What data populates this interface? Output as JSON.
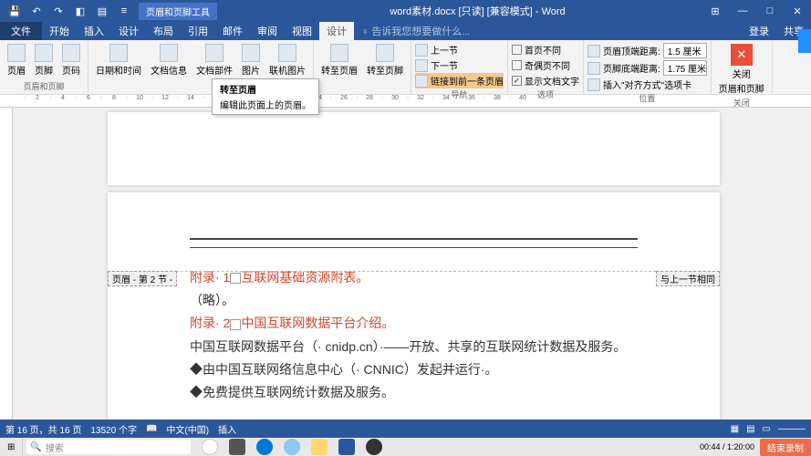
{
  "titlebar": {
    "tool_tab": "页眉和页脚工具",
    "filename": "word素材.docx [只读] [兼容模式] - Word"
  },
  "tabs": {
    "file": "文件",
    "list": [
      "开始",
      "插入",
      "设计",
      "布局",
      "引用",
      "邮件",
      "审阅",
      "视图"
    ],
    "active": "设计",
    "tell_me": "告诉我您想要做什么...",
    "login": "登录",
    "share": "共享"
  },
  "ribbon": {
    "g1": {
      "b1": "页眉",
      "b2": "页脚",
      "b3": "页码",
      "label": "页眉和页脚"
    },
    "g2": {
      "b1": "日期和时间",
      "b2": "文档信息",
      "b3": "文档部件",
      "b4": "图片",
      "b5": "联机图片"
    },
    "g3": {
      "b1": "转至页眉",
      "b2": "转至页脚"
    },
    "g4": {
      "b1": "上一节",
      "b2": "下一节",
      "b3": "链接到前一条页眉",
      "label": "导航"
    },
    "g5": {
      "c1": "首页不同",
      "c2": "奇偶页不同",
      "c3": "显示文档文字",
      "label": "选项"
    },
    "g6": {
      "l1": "页眉顶端距离:",
      "v1": "1.5 厘米",
      "l2": "页脚底端距离:",
      "v2": "1.75 厘米",
      "l3": "插入\"对齐方式\"选项卡",
      "label": "位置"
    },
    "g7": {
      "b1": "关闭",
      "b2": "页眉和页脚",
      "label": "关闭"
    }
  },
  "tooltip": {
    "title": "转至页眉",
    "desc": "编辑此页面上的页眉。"
  },
  "header_marks": {
    "left": "页眉 - 第 2 节 -",
    "right": "与上一节相同"
  },
  "doc": {
    "p1a": "附录· 1",
    "p1b": "互联网基础资源附表。",
    "p2": "（略）。",
    "p3a": "附录· 2",
    "p3b": "中国互联网数据平台介绍。",
    "p4": "中国互联网数据平台（· cnidp.cn）·——开放、共享的互联网统计数据及服务。",
    "p5": "◆由中国互联网络信息中心（· CNNIC）发起并运行·。",
    "p6": "◆免费提供互联网统计数据及服务。"
  },
  "statusbar": {
    "page": "第 16 页，共 16 页",
    "words": "13520 个字",
    "lang": "中文(中国)",
    "mode": "插入"
  },
  "taskbar": {
    "search": "搜索",
    "time": "00:44 / 1:20:00",
    "rec": "结束录制"
  }
}
